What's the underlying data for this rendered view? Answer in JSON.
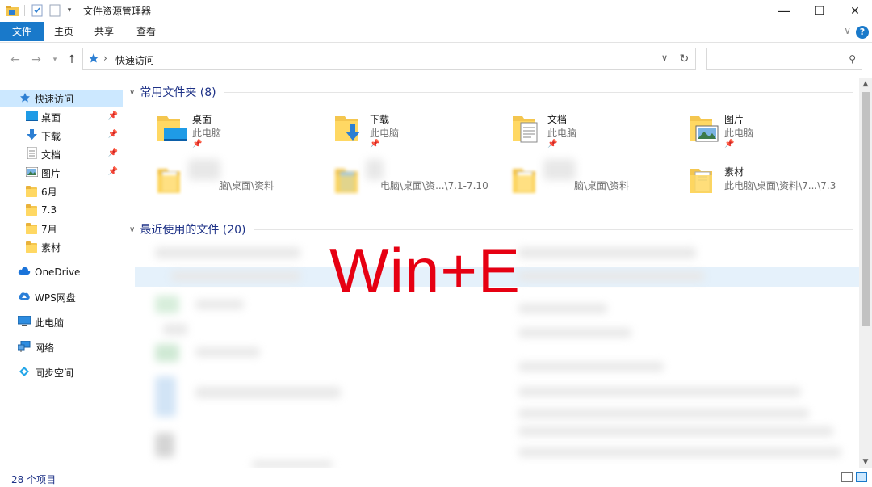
{
  "window": {
    "title": "文件资源管理器",
    "controls": {
      "minimize": "—",
      "maximize": "☐",
      "close": "✕"
    }
  },
  "ribbon": {
    "tabs": [
      {
        "label": "文件"
      },
      {
        "label": "主页"
      },
      {
        "label": "共享"
      },
      {
        "label": "查看"
      }
    ],
    "help": "?"
  },
  "address": {
    "location": "快速访问",
    "search_placeholder": ""
  },
  "navpane": {
    "items": [
      {
        "label": "快速访问",
        "icon": "star-icon",
        "selected": true
      },
      {
        "label": "桌面",
        "icon": "desktop-icon",
        "pinned": true
      },
      {
        "label": "下载",
        "icon": "download-icon",
        "pinned": true
      },
      {
        "label": "文档",
        "icon": "document-icon",
        "pinned": true
      },
      {
        "label": "图片",
        "icon": "picture-icon",
        "pinned": true
      },
      {
        "label": "6月",
        "icon": "folder-icon"
      },
      {
        "label": "7.3",
        "icon": "folder-icon"
      },
      {
        "label": "7月",
        "icon": "folder-icon"
      },
      {
        "label": "素材",
        "icon": "folder-icon"
      },
      {
        "label": "OneDrive",
        "icon": "cloud-icon"
      },
      {
        "label": "WPS网盘",
        "icon": "cloud-icon"
      },
      {
        "label": "此电脑",
        "icon": "computer-icon"
      },
      {
        "label": "网络",
        "icon": "network-icon"
      },
      {
        "label": "同步空间",
        "icon": "sync-icon"
      }
    ]
  },
  "content": {
    "frequent_header": "常用文件夹 (8)",
    "recent_header": "最近使用的文件 (20)",
    "frequent": [
      {
        "name": "桌面",
        "path": "此电脑"
      },
      {
        "name": "下载",
        "path": "此电脑"
      },
      {
        "name": "文档",
        "path": "此电脑"
      },
      {
        "name": "图片",
        "path": "此电脑"
      },
      {
        "name": "",
        "path": "脑\\桌面\\资料"
      },
      {
        "name": "",
        "path": "电脑\\桌面\\资...\\7.1-7.10"
      },
      {
        "name": "",
        "path": "脑\\桌面\\资料"
      },
      {
        "name": "素材",
        "path": "此电脑\\桌面\\资料\\7...\\7.3"
      }
    ]
  },
  "overlay": {
    "text": "Win+E"
  },
  "status": {
    "items_count": "28 个项目"
  },
  "colors": {
    "accent": "#1979ca",
    "header_text": "#1e3287",
    "overlay_red": "#e60012"
  }
}
